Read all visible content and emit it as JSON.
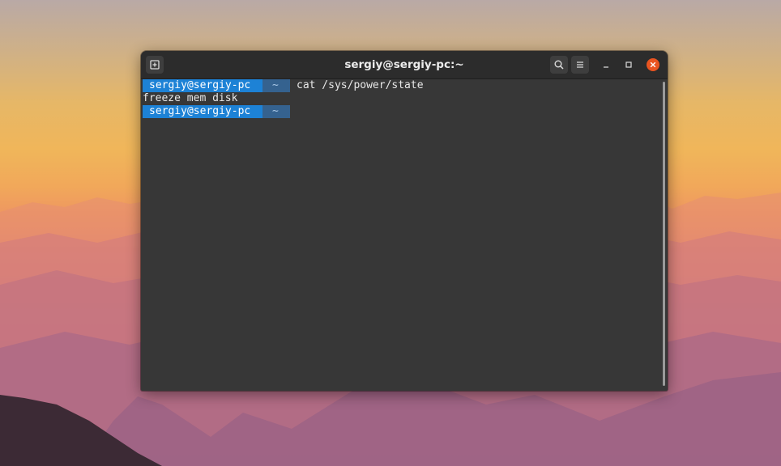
{
  "window": {
    "title": "sergiy@sergiy-pc:~"
  },
  "icons": {
    "new_tab": "new-tab-icon",
    "search": "search-icon",
    "menu": "hamburger-menu-icon",
    "minimize": "minimize-icon",
    "maximize": "maximize-icon",
    "close": "close-icon"
  },
  "terminal": {
    "prompt1": {
      "user": "sergiy@sergiy-pc",
      "dir": "~",
      "command": "cat /sys/power/state"
    },
    "output": "freeze mem disk",
    "prompt2": {
      "user": "sergiy@sergiy-pc",
      "dir": "~",
      "command": ""
    }
  },
  "colors": {
    "accent_close": "#e95420",
    "prompt_user_bg": "#1d82d6",
    "prompt_dir_bg": "#35628f",
    "terminal_bg": "#373737"
  }
}
